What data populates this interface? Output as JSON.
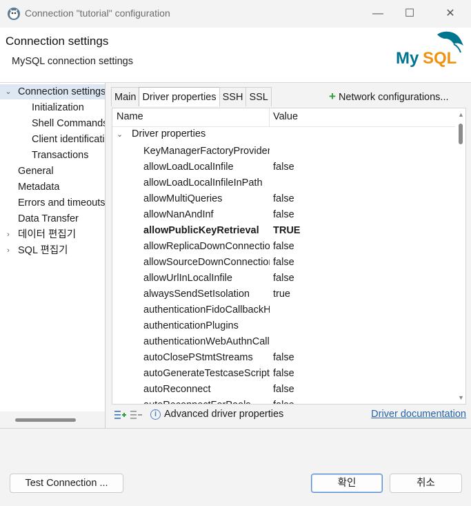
{
  "window": {
    "title": "Connection \"tutorial\" configuration",
    "controls": {
      "minimize": "—",
      "maximize": "☐",
      "close": "✕"
    }
  },
  "header": {
    "title": "Connection settings",
    "subtitle": "MySQL connection settings",
    "logo_text": "MySQL"
  },
  "nav": {
    "items": [
      {
        "label": "Connection settings",
        "level": 0,
        "expanded": true,
        "selected": true
      },
      {
        "label": "Initialization",
        "level": 1
      },
      {
        "label": "Shell Commands",
        "level": 1
      },
      {
        "label": "Client identification",
        "level": 1
      },
      {
        "label": "Transactions",
        "level": 1
      },
      {
        "label": "General",
        "level": 0
      },
      {
        "label": "Metadata",
        "level": 0
      },
      {
        "label": "Errors and timeouts",
        "level": 0
      },
      {
        "label": "Data Transfer",
        "level": 0
      },
      {
        "label": "데이터 편집기",
        "level": 0,
        "collapsed": true
      },
      {
        "label": "SQL 편집기",
        "level": 0,
        "collapsed": true
      }
    ]
  },
  "tabs": [
    {
      "label": "Main"
    },
    {
      "label": "Driver properties",
      "active": true
    },
    {
      "label": "SSH"
    },
    {
      "label": "SSL"
    }
  ],
  "network_config_label": "Network configurations...",
  "table": {
    "col_name": "Name",
    "col_value": "Value",
    "group_label": "Driver properties",
    "rows": [
      {
        "name": "KeyManagerFactoryProvider",
        "value": ""
      },
      {
        "name": "allowLoadLocalInfile",
        "value": "false"
      },
      {
        "name": "allowLoadLocalInfileInPath",
        "value": ""
      },
      {
        "name": "allowMultiQueries",
        "value": "false"
      },
      {
        "name": "allowNanAndInf",
        "value": "false"
      },
      {
        "name": "allowPublicKeyRetrieval",
        "value": "TRUE",
        "bold": true
      },
      {
        "name": "allowReplicaDownConnections",
        "value": "false"
      },
      {
        "name": "allowSourceDownConnections",
        "value": "false"
      },
      {
        "name": "allowUrlInLocalInfile",
        "value": "false"
      },
      {
        "name": "alwaysSendSetIsolation",
        "value": "true"
      },
      {
        "name": "authenticationFidoCallbackHandler",
        "value": ""
      },
      {
        "name": "authenticationPlugins",
        "value": ""
      },
      {
        "name": "authenticationWebAuthnCallbackHandler",
        "value": ""
      },
      {
        "name": "autoClosePStmtStreams",
        "value": "false"
      },
      {
        "name": "autoGenerateTestcaseScript",
        "value": "false"
      },
      {
        "name": "autoReconnect",
        "value": "false"
      },
      {
        "name": "autoReconnectForPools",
        "value": "false"
      }
    ]
  },
  "bottom": {
    "advanced_label": "Advanced driver properties",
    "doc_link": "Driver documentation"
  },
  "buttons": {
    "test_connection": "Test Connection ...",
    "ok": "확인",
    "cancel": "취소"
  },
  "colors": {
    "accent": "#2563a8",
    "selection": "#dde8f3",
    "mysql_blue": "#00758f",
    "mysql_orange": "#f29111"
  }
}
